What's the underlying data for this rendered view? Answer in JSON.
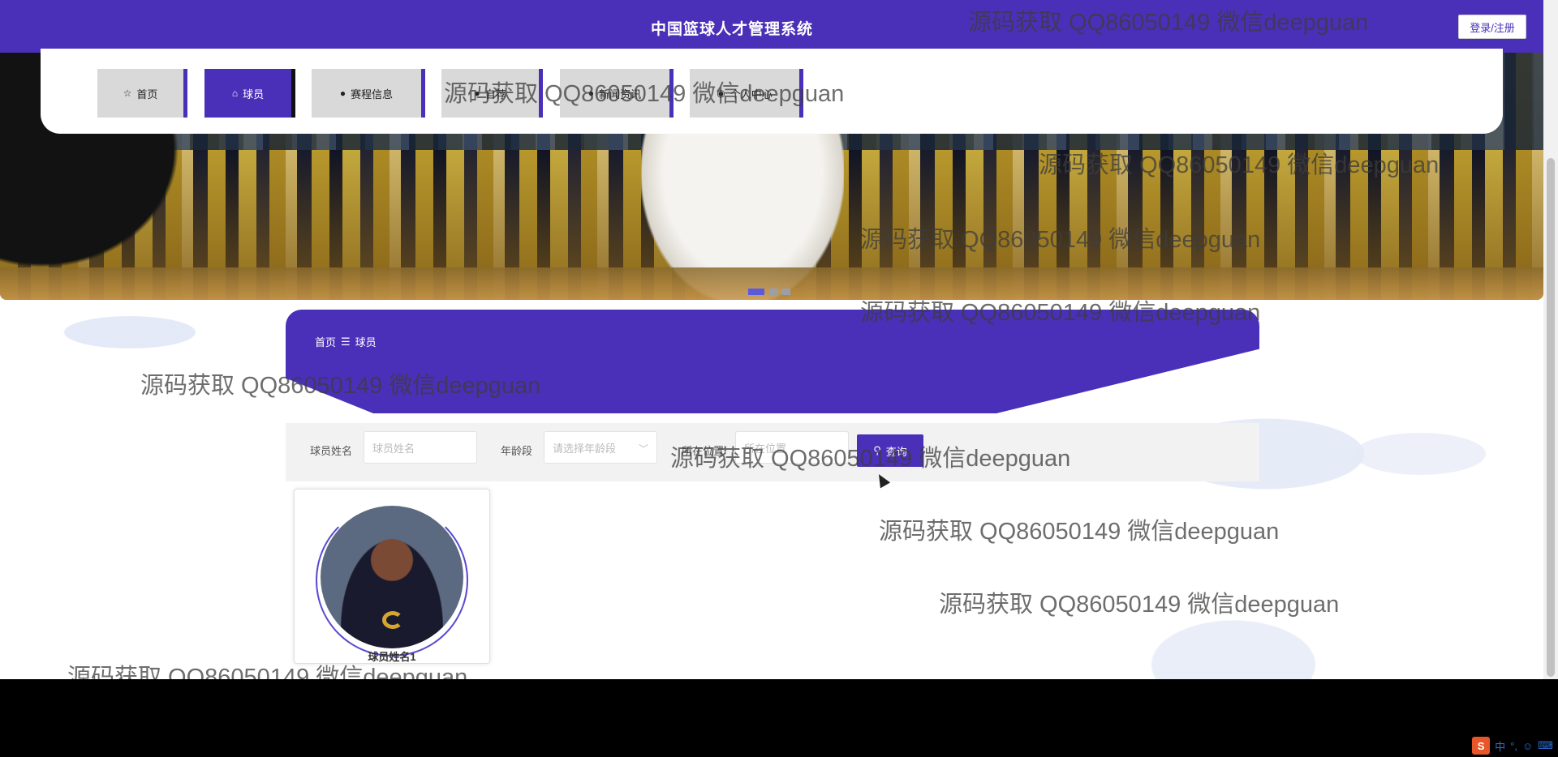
{
  "header": {
    "title": "中国篮球人才管理系统",
    "login_label": "登录/注册"
  },
  "nav": {
    "items": [
      {
        "label": "首页",
        "icon": "star-icon",
        "active": false
      },
      {
        "label": "球员",
        "icon": "bag-icon",
        "active": true
      },
      {
        "label": "赛程信息",
        "icon": "info-icon",
        "active": false
      },
      {
        "label": "自荐",
        "icon": "info-icon",
        "active": false
      },
      {
        "label": "新闻资讯",
        "icon": "info-icon",
        "active": false
      },
      {
        "label": "个人中心",
        "icon": "user-icon",
        "active": false
      }
    ]
  },
  "banner": {
    "slides": 3,
    "active_slide": 1
  },
  "breadcrumb": {
    "home": "首页",
    "separator": "☰",
    "current": "球员"
  },
  "search": {
    "name_label": "球员姓名",
    "name_placeholder": "球员姓名",
    "age_label": "年龄段",
    "age_placeholder": "请选择年龄段",
    "position_label": "所在位置",
    "position_placeholder": "所在位置",
    "button_label": "查询"
  },
  "players": [
    {
      "name": "球员姓名1"
    }
  ],
  "watermark": "源码获取 QQ86050149 微信deepguan",
  "tray": {
    "sogou": "S",
    "lang": "中",
    "punct": "°,",
    "emoji": "☺",
    "keyboard": "⌨"
  },
  "colors": {
    "primary": "#4a30b8",
    "nav_inactive": "#d9d9d9",
    "search_bg": "#f2f2f2"
  }
}
